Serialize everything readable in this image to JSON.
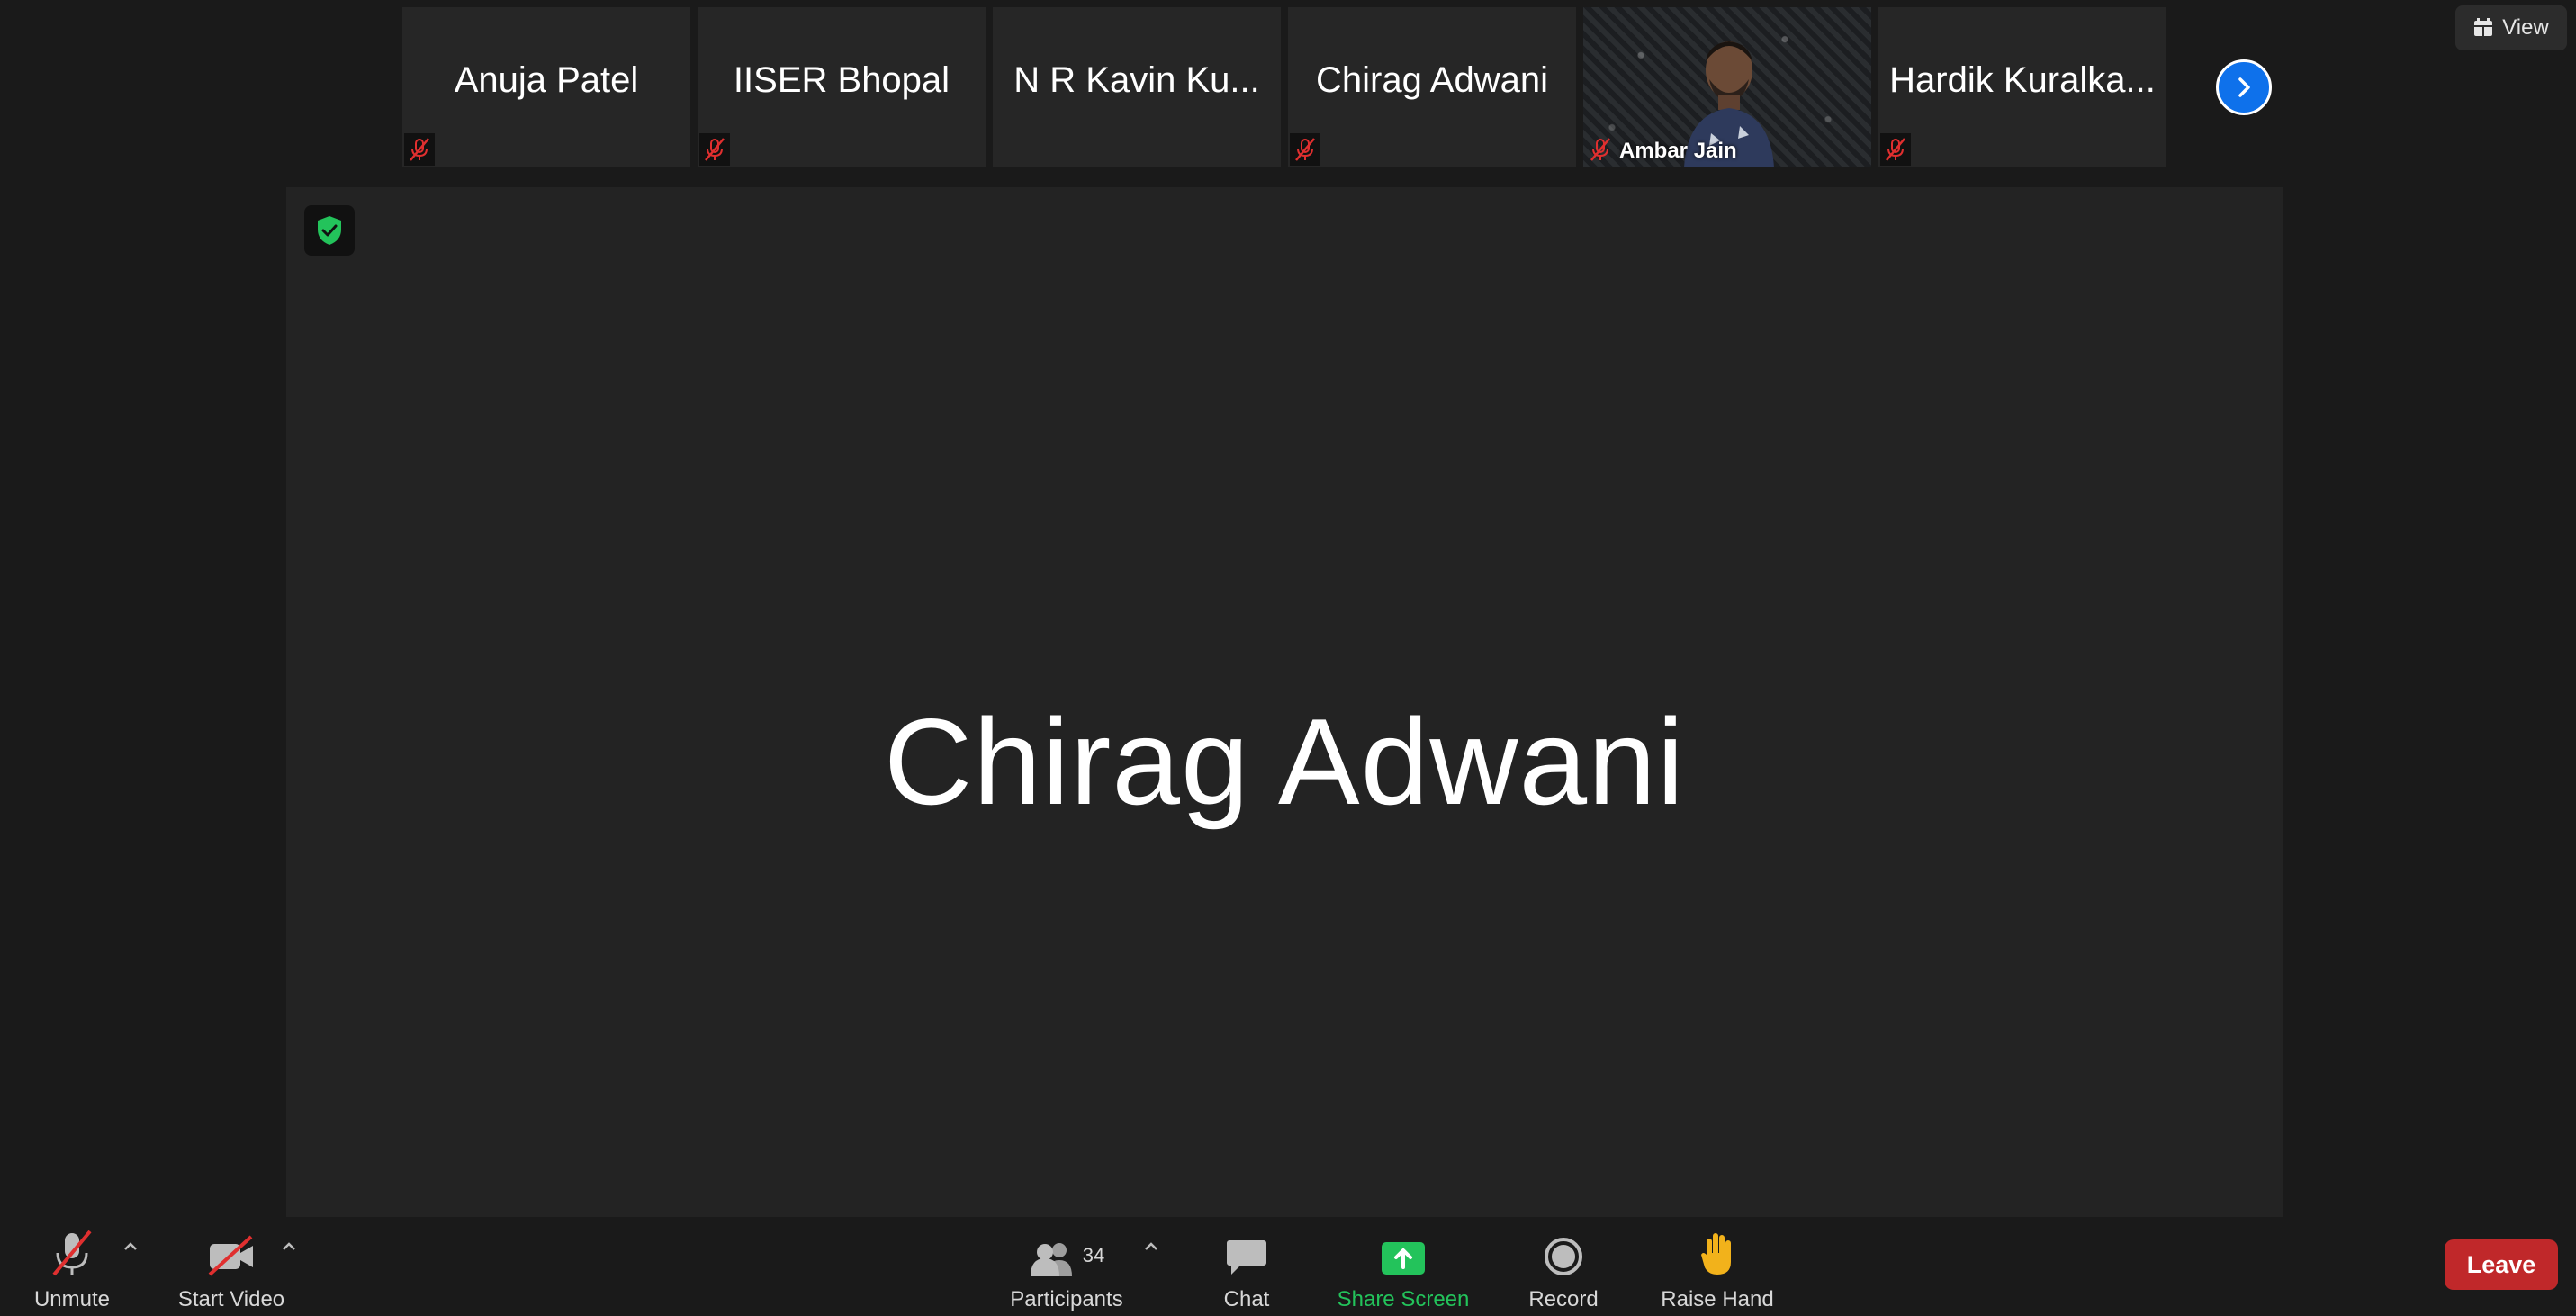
{
  "header": {
    "view_label": "View"
  },
  "gallery": {
    "tiles": [
      {
        "name": "Anuja Patel",
        "muted": true
      },
      {
        "name": "IISER Bhopal",
        "muted": true
      },
      {
        "name": "N R Kavin Ku...",
        "muted": false
      },
      {
        "name": "Chirag Adwani",
        "muted": true
      },
      {
        "name": "Ambar Jain",
        "muted": true,
        "video": true
      },
      {
        "name": "Hardik Kuralka...",
        "muted": true
      }
    ]
  },
  "stage": {
    "active_speaker": "Chirag Adwani"
  },
  "toolbar": {
    "unmute_label": "Unmute",
    "start_video_label": "Start Video",
    "participants_label": "Participants",
    "participants_count": "34",
    "chat_label": "Chat",
    "share_screen_label": "Share Screen",
    "record_label": "Record",
    "raise_hand_label": "Raise Hand",
    "leave_label": "Leave"
  },
  "colors": {
    "background": "#1a1a1a",
    "tile": "#262626",
    "share_green": "#23c35b",
    "leave_red": "#c0282a",
    "accent_blue": "#0e71eb",
    "muted_red": "#e02f2f"
  },
  "icons": [
    "view-grid-icon",
    "mic-muted-icon",
    "chevron-right-icon",
    "security-shield-icon",
    "mic-off-icon",
    "video-off-icon",
    "participants-icon",
    "chat-icon",
    "share-screen-icon",
    "record-icon",
    "raise-hand-icon",
    "caret-up-icon"
  ]
}
